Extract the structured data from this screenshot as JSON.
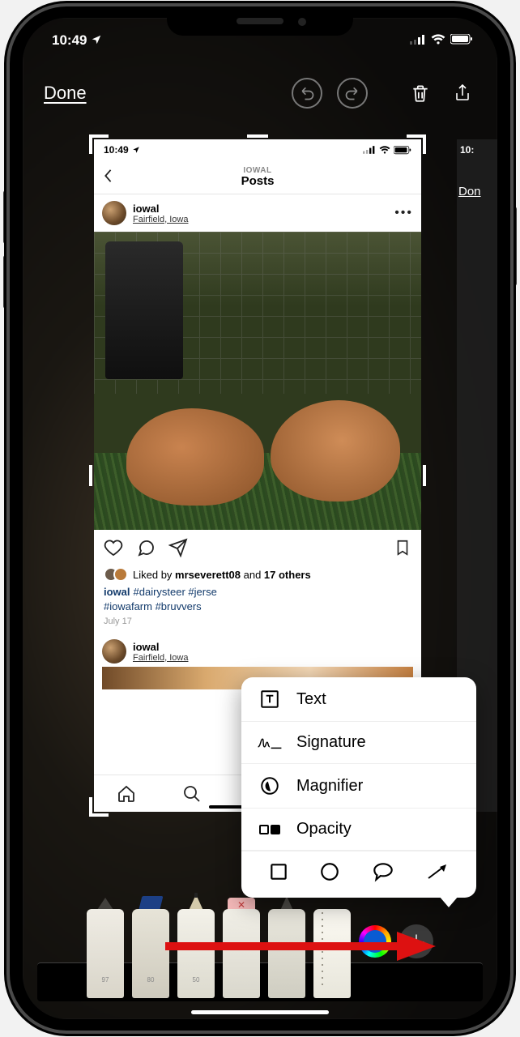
{
  "status": {
    "time": "10:49",
    "location_arrow": "➤"
  },
  "toolbar": {
    "done": "Done"
  },
  "peek": {
    "time": "10:",
    "done": "Don"
  },
  "instagram": {
    "status_time": "10:49",
    "nav_user": "IOWAL",
    "nav_title": "Posts",
    "post": {
      "username": "iowal",
      "location": "Fairfield, Iowa",
      "likes_prefix": "Liked by ",
      "likes_user": "mrseverett08",
      "likes_mid": " and ",
      "likes_count": "17 others",
      "caption_user": "iowal",
      "caption_tags": "#dairysteer #jerse",
      "caption_tags2": "#iowafarm #bruvvers",
      "date": "July 17"
    },
    "post2": {
      "username": "iowal",
      "location": "Fairfield, Iowa"
    }
  },
  "popover": {
    "text": "Text",
    "signature": "Signature",
    "magnifier": "Magnifier",
    "opacity": "Opacity"
  },
  "tools": {
    "pen1_label": "97",
    "pen2_label": "80",
    "pen3_label": "50"
  }
}
